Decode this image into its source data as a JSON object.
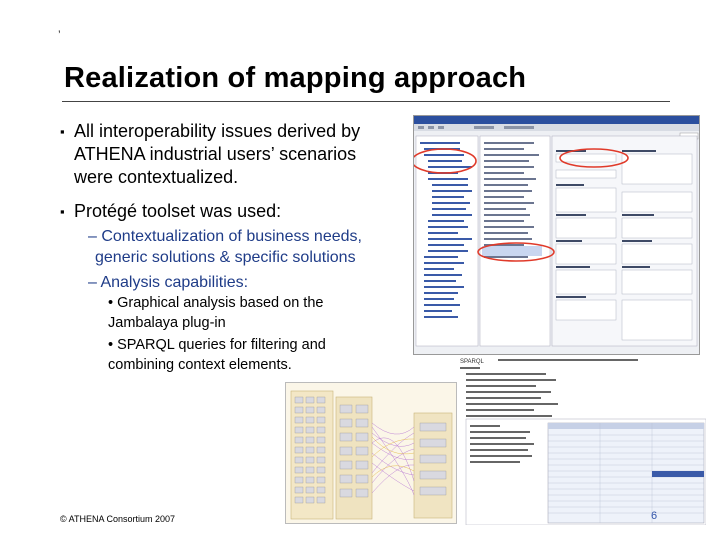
{
  "slide": {
    "corner_mark": "’",
    "title": "Realization of mapping approach",
    "bullets": [
      {
        "marker": "▪",
        "lines": [
          "All interoperability issues derived by",
          "ATHENA industrial users’ scenarios",
          "were contextualized."
        ]
      },
      {
        "marker": "▪",
        "lines": [
          "Protégé toolset was used:"
        ]
      }
    ],
    "sub_bullets": [
      {
        "lines": [
          "– Contextualization of business needs,",
          "generic solutions & specific solutions"
        ]
      },
      {
        "lines": [
          "– Analysis capabilities:"
        ]
      }
    ],
    "sub_sub_bullets": [
      {
        "lines": [
          "• Graphical analysis based on the",
          "Jambalaya plug-in"
        ]
      },
      {
        "lines": [
          "• SPARQL queries for filtering and",
          "combining context elements."
        ]
      }
    ],
    "footer": "© ATHENA Consortium 2007",
    "page_number": "6"
  },
  "screenshots": {
    "protege": {
      "icon": "protege-window-screenshot"
    },
    "sparql": {
      "query_heading": "SPARQL"
    },
    "jambalaya": {
      "icon": "jambalaya-graph-screenshot"
    }
  },
  "colors": {
    "title": "#000000",
    "sub_bullet": "#1f3c88",
    "highlight_circle": "#e03a2a"
  }
}
